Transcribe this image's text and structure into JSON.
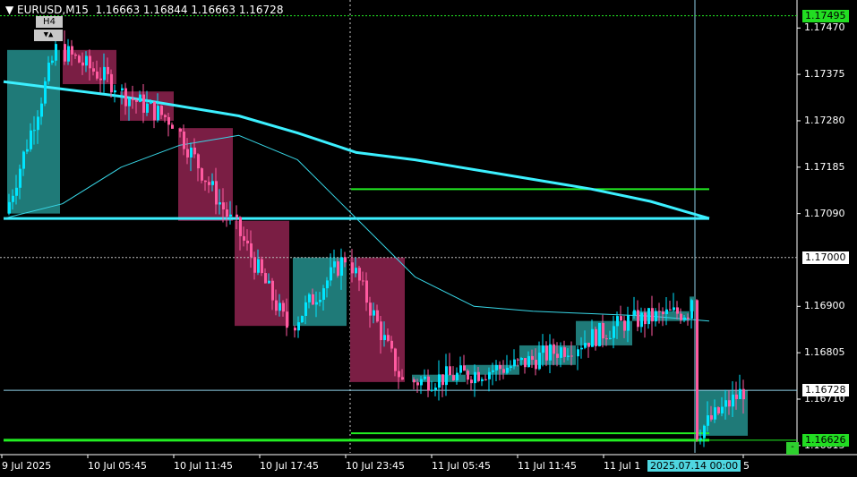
{
  "header": {
    "symbol": "EURUSD,M15",
    "open": "1.16663",
    "high": "1.16844",
    "low": "1.16663",
    "close": "1.16728"
  },
  "timeframe_box": "H4",
  "nav_buttons": "▼▲",
  "y_ticks": [
    {
      "label": "1.17470",
      "value": 1.1747
    },
    {
      "label": "1.17375",
      "value": 1.17375
    },
    {
      "label": "1.17280",
      "value": 1.1728
    },
    {
      "label": "1.17185",
      "value": 1.17185
    },
    {
      "label": "1.17090",
      "value": 1.1709
    },
    {
      "label": "1.16900",
      "value": 1.169
    },
    {
      "label": "1.16805",
      "value": 1.16805
    },
    {
      "label": "1.16710",
      "value": 1.1671
    },
    {
      "label": "1.16615",
      "value": 1.16615
    }
  ],
  "price_tags": [
    {
      "label": "1.17495",
      "value": 1.17495,
      "bg": "#22dd22",
      "fg": "#000000"
    },
    {
      "label": "1.17000",
      "value": 1.17,
      "bg": "#ffffff",
      "fg": "#000000"
    },
    {
      "label": "1.16728",
      "value": 1.16728,
      "bg": "#ffffff",
      "fg": "#000000"
    },
    {
      "label": "1.16626",
      "value": 1.16626,
      "bg": "#22dd22",
      "fg": "#000000"
    }
  ],
  "x_ticks": [
    {
      "label": "9 Jul 2025"
    },
    {
      "label": "10 Jul 05:45"
    },
    {
      "label": "10 Jul 11:45"
    },
    {
      "label": "10 Jul 17:45"
    },
    {
      "label": "10 Jul 23:45"
    },
    {
      "label": "11 Jul 05:45"
    },
    {
      "label": "11 Jul 11:45"
    },
    {
      "label": "11 Jul 1"
    },
    {
      "label": "5"
    }
  ],
  "crosshair_time": "2025.07.14 00:00",
  "mini_button": "-",
  "colors": {
    "background": "#000000",
    "bull": "#00e5ff",
    "bear": "#ff5aa0",
    "ma_slow": "#3cf0ff",
    "ma_fast": "#38d8e8",
    "level_green": "#22ee22",
    "level_cyan": "#3cf0ff",
    "h4_bull_box": "#1f7a78",
    "h4_bear_box": "#7a1e44"
  },
  "chart_data": {
    "type": "candlestick",
    "symbol": "EURUSD",
    "timeframe": "M15",
    "overlay_timeframe": "H4",
    "ylim": [
      1.166,
      1.1752
    ],
    "h4_boxes": [
      {
        "o": 1.1709,
        "c": 1.17425,
        "dir": "up"
      },
      {
        "o": 1.17425,
        "c": 1.17355,
        "dir": "down"
      },
      {
        "o": 1.1734,
        "c": 1.1728,
        "dir": "down"
      },
      {
        "o": 1.17265,
        "c": 1.17075,
        "dir": "down"
      },
      {
        "o": 1.17075,
        "c": 1.1686,
        "dir": "down"
      },
      {
        "o": 1.1686,
        "c": 1.17,
        "dir": "up"
      },
      {
        "o": 1.17,
        "c": 1.16745,
        "dir": "down"
      },
      {
        "o": 1.16745,
        "c": 1.1676,
        "dir": "up"
      },
      {
        "o": 1.1676,
        "c": 1.1678,
        "dir": "up"
      },
      {
        "o": 1.1678,
        "c": 1.1682,
        "dir": "up"
      },
      {
        "o": 1.1682,
        "c": 1.1687,
        "dir": "up"
      },
      {
        "o": 1.1687,
        "c": 1.1689,
        "dir": "up"
      },
      {
        "o": 1.1689,
        "c": 1.1692,
        "dir": "up"
      },
      {
        "o": 1.16635,
        "c": 1.16728,
        "dir": "up"
      }
    ],
    "levels": [
      {
        "price": 1.17495,
        "kind": "green-dotted"
      },
      {
        "price": 1.17,
        "kind": "gray-dotted"
      },
      {
        "price": 1.1714,
        "kind": "green"
      },
      {
        "price": 1.1708,
        "kind": "cyan-thick"
      },
      {
        "price": 1.1664,
        "kind": "green"
      },
      {
        "price": 1.16626,
        "kind": "green-thick"
      },
      {
        "price": 1.16728,
        "kind": "cyan-thin"
      }
    ],
    "ma_slow": [
      1.1736,
      1.17345,
      1.1733,
      1.1731,
      1.1729,
      1.17255,
      1.17215,
      1.172,
      1.1718,
      1.1716,
      1.1714,
      1.17115,
      1.1708
    ],
    "ma_fast": [
      1.1708,
      1.1711,
      1.17185,
      1.1723,
      1.1725,
      1.172,
      1.1708,
      1.1696,
      1.169,
      1.1689,
      1.16885,
      1.1688,
      1.1687
    ]
  }
}
